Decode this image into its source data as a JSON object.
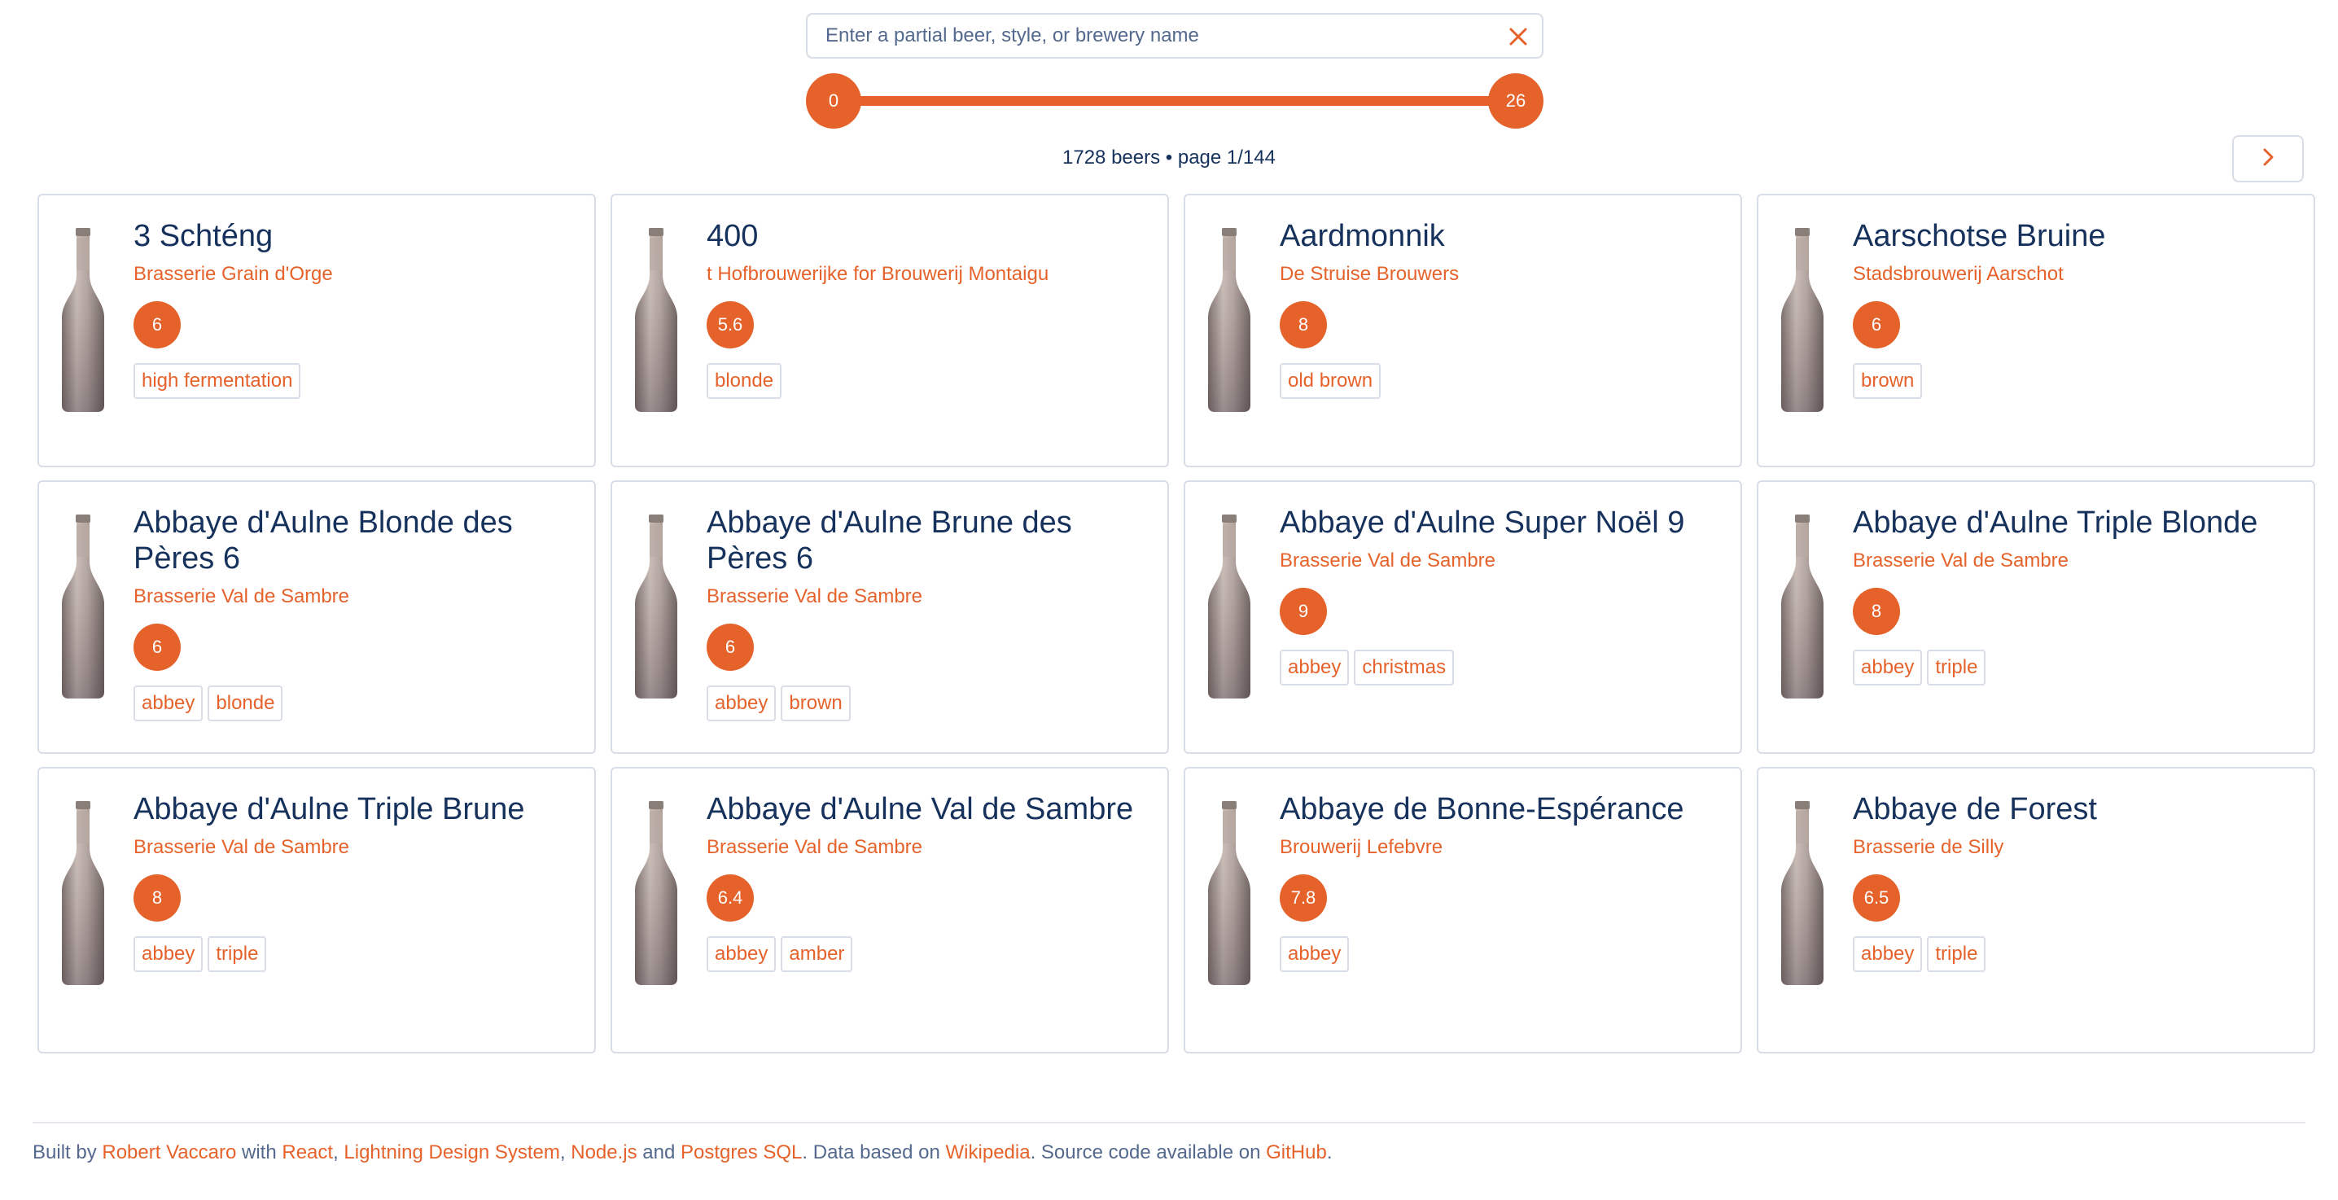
{
  "search": {
    "placeholder": "Enter a partial beer, style, or brewery name",
    "value": ""
  },
  "slider": {
    "min_label": "0",
    "max_label": "26",
    "range_min": 0,
    "range_max": 26,
    "selected_min": 0,
    "selected_max": 26
  },
  "status": {
    "text": "1728 beers • page 1/144"
  },
  "colors": {
    "accent": "#e5622b",
    "text": "#16325c",
    "border": "#d8dde6"
  },
  "icons": {
    "clear": "close-icon",
    "next": "chevron-right-icon",
    "bottle": "beer-bottle-icon"
  },
  "beers": [
    {
      "name": "3 Schténg",
      "brewery": "Brasserie Grain d'Orge",
      "abv": "6",
      "tags": [
        "high fermentation"
      ]
    },
    {
      "name": "400",
      "brewery": "t Hofbrouwerijke for Brouwerij Montaigu",
      "abv": "5.6",
      "tags": [
        "blonde"
      ]
    },
    {
      "name": "Aardmonnik",
      "brewery": "De Struise Brouwers",
      "abv": "8",
      "tags": [
        "old brown"
      ]
    },
    {
      "name": "Aarschotse Bruine",
      "brewery": "Stadsbrouwerij Aarschot",
      "abv": "6",
      "tags": [
        "brown"
      ]
    },
    {
      "name": "Abbaye d'Aulne Blonde des Pères 6",
      "brewery": "Brasserie Val de Sambre",
      "abv": "6",
      "tags": [
        "abbey",
        "blonde"
      ]
    },
    {
      "name": "Abbaye d'Aulne Brune des Pères 6",
      "brewery": "Brasserie Val de Sambre",
      "abv": "6",
      "tags": [
        "abbey",
        "brown"
      ]
    },
    {
      "name": "Abbaye d'Aulne Super Noël 9",
      "brewery": "Brasserie Val de Sambre",
      "abv": "9",
      "tags": [
        "abbey",
        "christmas"
      ]
    },
    {
      "name": "Abbaye d'Aulne Triple Blonde",
      "brewery": "Brasserie Val de Sambre",
      "abv": "8",
      "tags": [
        "abbey",
        "triple"
      ]
    },
    {
      "name": "Abbaye d'Aulne Triple Brune",
      "brewery": "Brasserie Val de Sambre",
      "abv": "8",
      "tags": [
        "abbey",
        "triple"
      ]
    },
    {
      "name": "Abbaye d'Aulne Val de Sambre",
      "brewery": "Brasserie Val de Sambre",
      "abv": "6.4",
      "tags": [
        "abbey",
        "amber"
      ]
    },
    {
      "name": "Abbaye de Bonne-Espérance",
      "brewery": "Brouwerij Lefebvre",
      "abv": "7.8",
      "tags": [
        "abbey"
      ]
    },
    {
      "name": "Abbaye de Forest",
      "brewery": "Brasserie de Silly",
      "abv": "6.5",
      "tags": [
        "abbey",
        "triple"
      ]
    }
  ],
  "footer": {
    "t1": "Built by ",
    "author": "Robert Vaccaro",
    "t2": " with ",
    "react": "React",
    "t3": ", ",
    "lds": "Lightning Design System",
    "t4": ", ",
    "node": "Node.js",
    "t5": " and ",
    "pg": "Postgres SQL",
    "t6": ". Data based on ",
    "wiki": "Wikipedia",
    "t7": ". Source code available on ",
    "github": "GitHub",
    "t8": "."
  }
}
